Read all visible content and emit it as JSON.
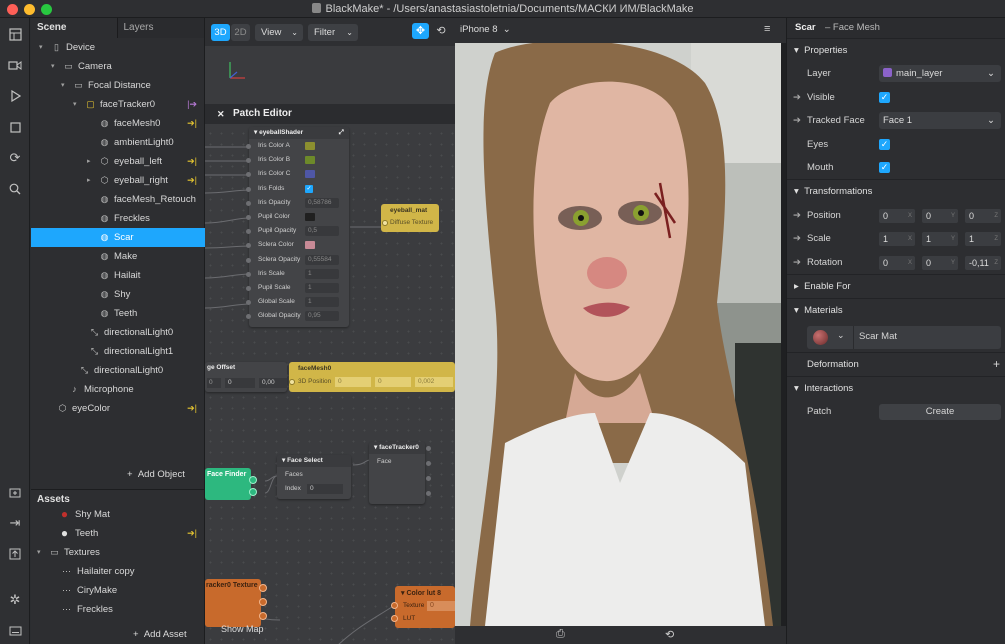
{
  "window": {
    "title": "BlackMake* - /Users/anastasiastoletnia/Documents/МАСКИ ИМ/BlackMake"
  },
  "colors": {
    "accent": "#1ea7fd",
    "tag_yellow": "#e5c531",
    "tag_purple": "#b77ad6",
    "layer_swatch": "#8b62c9"
  },
  "toolbar": {
    "icons": [
      "layout-icon",
      "video-camera-icon",
      "play-icon",
      "stop-icon",
      "refresh-icon",
      "search-icon",
      "import-icon",
      "sign-in-icon",
      "upload-icon",
      "bug-icon",
      "keyboard-icon"
    ]
  },
  "scene": {
    "tabs": [
      "Scene",
      "Layers"
    ],
    "items": [
      {
        "label": "Device",
        "icon": "device-icon",
        "tag": ""
      },
      {
        "label": "Camera",
        "icon": "camera-icon",
        "tag": ""
      },
      {
        "label": "Focal Distance",
        "icon": "focal-distance-icon",
        "tag": ""
      },
      {
        "label": "faceTracker0",
        "icon": "face-tracker-icon",
        "tag": "purple"
      },
      {
        "label": "faceMesh0",
        "icon": "mesh-icon",
        "tag": "yellow"
      },
      {
        "label": "ambientLight0",
        "icon": "light-icon",
        "tag": ""
      },
      {
        "label": "eyeball_left",
        "icon": "cube-icon",
        "tag": "yellow"
      },
      {
        "label": "eyeball_right",
        "icon": "cube-icon",
        "tag": "yellow"
      },
      {
        "label": "faceMesh_Retouch",
        "icon": "mesh-icon",
        "tag": ""
      },
      {
        "label": "Freckles",
        "icon": "mesh-icon",
        "tag": ""
      },
      {
        "label": "Scar",
        "icon": "mesh-icon",
        "tag": ""
      },
      {
        "label": "Make",
        "icon": "mesh-icon",
        "tag": ""
      },
      {
        "label": "Hailait",
        "icon": "mesh-icon",
        "tag": ""
      },
      {
        "label": "Shy",
        "icon": "mesh-icon",
        "tag": ""
      },
      {
        "label": "Teeth",
        "icon": "mesh-icon",
        "tag": ""
      },
      {
        "label": "directionalLight0",
        "icon": "directional-light-icon",
        "tag": ""
      },
      {
        "label": "directionalLight1",
        "icon": "directional-light-icon",
        "tag": ""
      },
      {
        "label": "directionalLight0",
        "icon": "directional-light-icon",
        "tag": ""
      },
      {
        "label": "Microphone",
        "icon": "microphone-icon",
        "tag": ""
      },
      {
        "label": "eyeColor",
        "icon": "package-icon",
        "tag": "yellow"
      }
    ],
    "selected": "Scar",
    "add_object": "Add Object"
  },
  "assets": {
    "title": "Assets",
    "items": [
      {
        "label": "Shy Mat",
        "icon": "material-red-icon",
        "tag": ""
      },
      {
        "label": "Teeth",
        "icon": "material-white-icon",
        "tag": "yellow"
      },
      {
        "label": "Textures",
        "icon": "folder-icon",
        "tag": ""
      },
      {
        "label": "Hailaiter copy",
        "icon": "texture-icon",
        "tag": ""
      },
      {
        "label": "CiryMake",
        "icon": "texture-icon",
        "tag": ""
      },
      {
        "label": "Freckles",
        "icon": "texture-icon",
        "tag": ""
      }
    ],
    "add_asset": "Add Asset"
  },
  "viewport": {
    "mode_3d": "3D",
    "mode_2d": "2D",
    "view": "View",
    "filter": "Filter",
    "device": "iPhone 8"
  },
  "patch_editor": {
    "title": "Patch Editor",
    "eyeball_shader": {
      "title": "eyeballShader",
      "rows": [
        {
          "label": "Iris Color A",
          "value": "",
          "swatch": "#8c8f2f"
        },
        {
          "label": "Iris Color B",
          "value": "",
          "swatch": "#6d8a2a"
        },
        {
          "label": "Iris Color C",
          "value": "",
          "swatch": "#4f57a6"
        },
        {
          "label": "Iris Folds",
          "value": "",
          "swatch": "",
          "check": true
        },
        {
          "label": "Iris Opacity",
          "value": "0,58786",
          "swatch": ""
        },
        {
          "label": "Pupil Color",
          "value": "",
          "swatch": "#202020"
        },
        {
          "label": "Pupil Opacity",
          "value": "0,5",
          "swatch": ""
        },
        {
          "label": "Sclera Color",
          "value": "",
          "swatch": "#c88a96"
        },
        {
          "label": "Sclera Opacity",
          "value": "0,55584",
          "swatch": ""
        },
        {
          "label": "Iris Scale",
          "value": "1",
          "swatch": ""
        },
        {
          "label": "Pupil Scale",
          "value": "1",
          "swatch": ""
        },
        {
          "label": "Global Scale",
          "value": "1",
          "swatch": ""
        },
        {
          "label": "Global Opacity",
          "value": "0,95",
          "swatch": ""
        }
      ]
    },
    "eyeball_mat": {
      "title": "eyeball_mat",
      "port": "Diffuse Texture"
    },
    "edge_offset": {
      "title": "ge Offset",
      "v1": "0",
      "v2": "0",
      "v3": "0,00"
    },
    "face_mesh": {
      "title": "faceMesh0",
      "port": "3D Position",
      "x": "0",
      "y": "0",
      "z": "0,002"
    },
    "face_finder": {
      "title": "Face Finder"
    },
    "face_select": {
      "title": "Face Select",
      "port1": "Faces",
      "port2": "Index",
      "index": "0"
    },
    "face_tracker": {
      "title": "faceTracker0",
      "port": "Face"
    },
    "tracker_texture": {
      "title": "racker0 Texture"
    },
    "color_lut": {
      "title": "Color lut 8",
      "port1": "Texture",
      "port2": "LUT",
      "v": "0"
    },
    "show_map": "Show Map"
  },
  "properties": {
    "header_name": "Scar",
    "header_type": "– Face Mesh",
    "properties_section": "Properties",
    "layer_label": "Layer",
    "layer_value": "main_layer",
    "visible_label": "Visible",
    "tracked_face_label": "Tracked Face",
    "tracked_face_value": "Face 1",
    "eyes_label": "Eyes",
    "mouth_label": "Mouth",
    "transformations_section": "Transformations",
    "position_label": "Position",
    "position": [
      "0",
      "0",
      "0"
    ],
    "scale_label": "Scale",
    "scale": [
      "1",
      "1",
      "1"
    ],
    "rotation_label": "Rotation",
    "rotation": [
      "0",
      "0",
      "-0,11"
    ],
    "axes": [
      "X",
      "Y",
      "Z"
    ],
    "enable_for_section": "Enable For",
    "materials_section": "Materials",
    "material_value": "Scar Mat",
    "deformation_section": "Deformation",
    "interactions_section": "Interactions",
    "patch_label": "Patch",
    "create_button": "Create"
  }
}
